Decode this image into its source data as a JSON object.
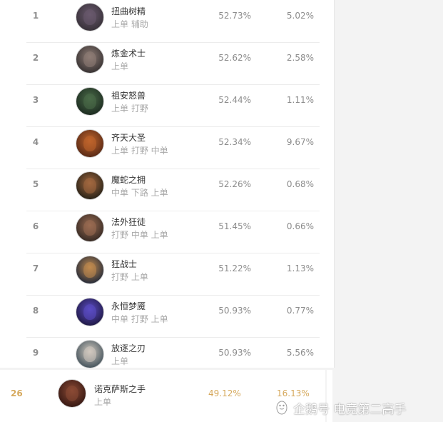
{
  "rows": [
    {
      "rank": "1",
      "name": "扭曲树精",
      "roles": "上单 辅助",
      "winrate": "52.73%",
      "pickrate": "5.02%",
      "avatar_colors": [
        "#39323a",
        "#6a5a6e"
      ]
    },
    {
      "rank": "2",
      "name": "炼金术士",
      "roles": "上单",
      "winrate": "52.62%",
      "pickrate": "2.58%",
      "avatar_colors": [
        "#3b3535",
        "#8f7d76"
      ]
    },
    {
      "rank": "3",
      "name": "祖安怒兽",
      "roles": "上单 打野",
      "winrate": "52.44%",
      "pickrate": "1.11%",
      "avatar_colors": [
        "#1e2e22",
        "#4b6b48"
      ]
    },
    {
      "rank": "4",
      "name": "齐天大圣",
      "roles": "上单 打野 中单",
      "winrate": "52.34%",
      "pickrate": "9.67%",
      "avatar_colors": [
        "#5c2b16",
        "#c0652c"
      ]
    },
    {
      "rank": "5",
      "name": "魔蛇之拥",
      "roles": "中单 下路 上单",
      "winrate": "52.26%",
      "pickrate": "0.68%",
      "avatar_colors": [
        "#2c2418",
        "#a3683f"
      ]
    },
    {
      "rank": "6",
      "name": "法外狂徒",
      "roles": "打野 中单 上单",
      "winrate": "51.45%",
      "pickrate": "0.66%",
      "avatar_colors": [
        "#3a2c25",
        "#9a6c52"
      ]
    },
    {
      "rank": "7",
      "name": "狂战士",
      "roles": "打野 上单",
      "winrate": "51.22%",
      "pickrate": "1.13%",
      "avatar_colors": [
        "#2a2e3a",
        "#c18b4f"
      ]
    },
    {
      "rank": "8",
      "name": "永恒梦魇",
      "roles": "中单 打野 上单",
      "winrate": "50.93%",
      "pickrate": "0.77%",
      "avatar_colors": [
        "#221b4a",
        "#5b4cc4"
      ]
    },
    {
      "rank": "9",
      "name": "放逐之刃",
      "roles": "上单",
      "winrate": "50.93%",
      "pickrate": "5.56%",
      "avatar_colors": [
        "#4a5860",
        "#d1c9bf"
      ]
    }
  ],
  "highlight": {
    "rank": "26",
    "name": "诺克萨斯之手",
    "roles": "上单",
    "winrate": "49.12%",
    "pickrate": "16.13%",
    "avatar_colors": [
      "#3a1a14",
      "#8b4a35"
    ],
    "color": "#d6a95d"
  },
  "watermark": {
    "text": "企鹅号 电竞第二高手",
    "icon": "penguin-logo-icon"
  }
}
